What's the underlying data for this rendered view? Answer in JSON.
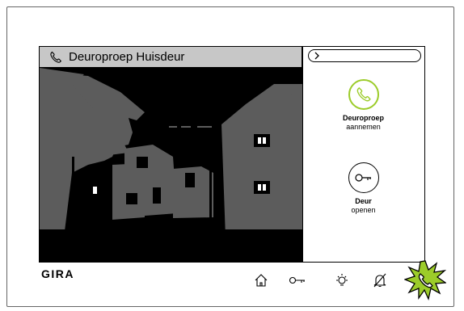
{
  "call": {
    "title": "Deuroproep Huisdeur",
    "icon": "handset-icon"
  },
  "actions": [
    {
      "icon": "handset-icon",
      "line1": "Deuroproep",
      "line2": "aannemen",
      "accent": "#9ccc2a"
    },
    {
      "icon": "key-icon",
      "line1": "Deur",
      "line2": "openen"
    }
  ],
  "brand": "GIRA",
  "nav": [
    {
      "name": "home-icon"
    },
    {
      "name": "key-icon"
    },
    {
      "name": "light-bulb-icon"
    },
    {
      "name": "bell-off-icon"
    },
    {
      "name": "ringing-handset-icon",
      "accent": "#9ccc2a"
    }
  ],
  "colors": {
    "accent": "#9ccc2a",
    "titlebar": "#c7c7c7",
    "video_gray": "#5c5c5c"
  }
}
